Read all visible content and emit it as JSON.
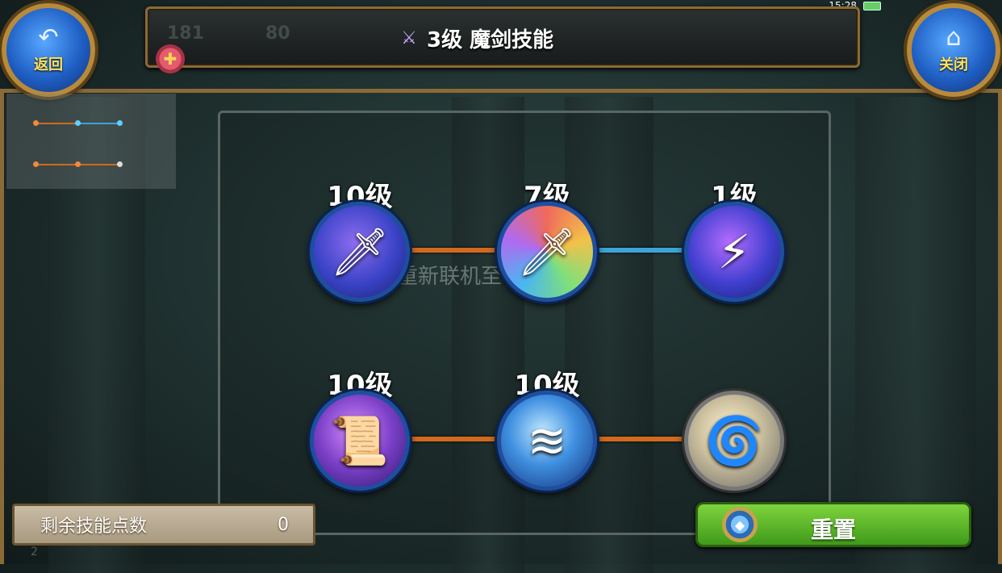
{
  "status": {
    "time": "15:28"
  },
  "header": {
    "title": "3级 魔剑技能",
    "back_label": "返回",
    "close_label": "关闭",
    "ghost_stats": [
      "181",
      "80"
    ]
  },
  "ghost_text": "重新联机至",
  "skills": [
    {
      "level_label": "10级",
      "icon": "sword-magic-icon",
      "row": 1,
      "col": 1
    },
    {
      "level_label": "7级",
      "icon": "sword-swirl-icon",
      "row": 1,
      "col": 2
    },
    {
      "level_label": "1级",
      "icon": "sword-lightning-icon",
      "row": 1,
      "col": 3
    },
    {
      "level_label": "10级",
      "icon": "scroll-ring-icon",
      "row": 2,
      "col": 1
    },
    {
      "level_label": "10级",
      "icon": "slash-wind-icon",
      "row": 2,
      "col": 2
    },
    {
      "level_label": "",
      "icon": "whirlwind-icon",
      "row": 2,
      "col": 3
    }
  ],
  "skill_points": {
    "label": "剩余技能点数",
    "value": "0"
  },
  "reset": {
    "label": "重置"
  },
  "colors": {
    "accent_gold": "#8a6a36",
    "reset_green": "#5bb52a",
    "connector_orange": "#d2691e",
    "connector_blue": "#3ba4d8",
    "skill_blue": "#1f5fc4"
  }
}
